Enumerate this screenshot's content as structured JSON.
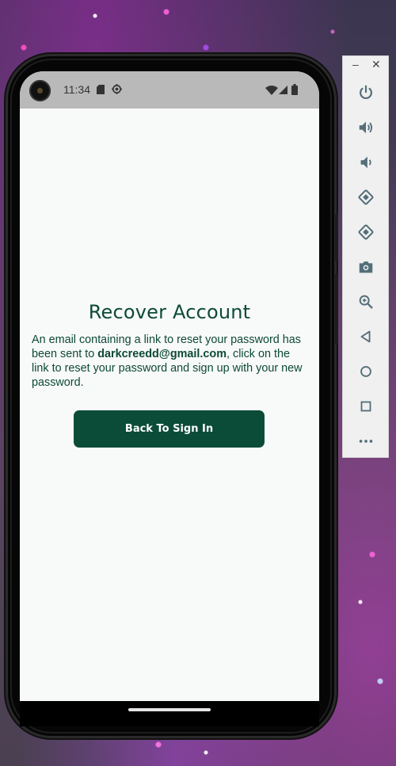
{
  "status_bar": {
    "time": "11:34",
    "icons": [
      "sd-card-icon",
      "gear-icon",
      "wifi-icon",
      "signal-icon",
      "battery-icon"
    ]
  },
  "recover": {
    "title": "Recover Account",
    "message_prefix": "An email containing a link to reset your password has been sent to ",
    "email": "darkcreedd@gmail.com",
    "message_suffix": ", click on the link to reset your password and sign up with your new password.",
    "button_label": "Back To Sign In"
  },
  "toolbar": {
    "minimize_label": "–",
    "close_label": "✕",
    "items": [
      "power-icon",
      "volume-up-icon",
      "volume-down-icon",
      "rotate-left-icon",
      "rotate-right-icon",
      "camera-icon",
      "zoom-icon",
      "back-icon",
      "home-icon",
      "overview-icon",
      "more-icon"
    ]
  },
  "colors": {
    "primary": "#0b4c38",
    "text": "#0d4a37",
    "screen_bg": "#f8f9f9",
    "status_bar_bg": "#b9b9b9"
  }
}
